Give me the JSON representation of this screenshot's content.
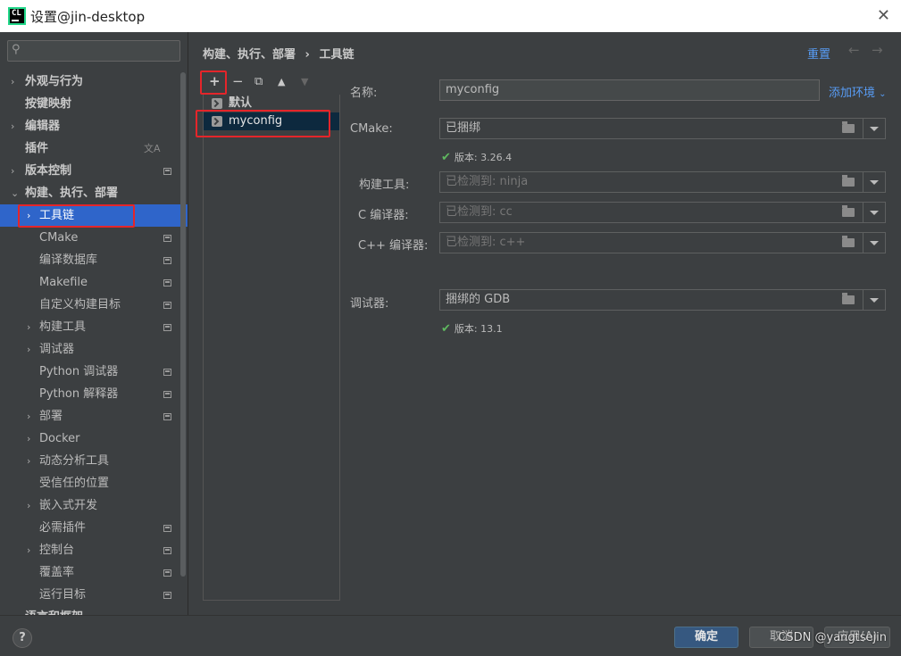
{
  "window": {
    "title": "设置@jin-desktop"
  },
  "search": {
    "placeholder": ""
  },
  "sidebar": {
    "items": [
      {
        "label": "外观与行为"
      },
      {
        "label": "按键映射"
      },
      {
        "label": "编辑器"
      },
      {
        "label": "插件"
      },
      {
        "label": "版本控制"
      },
      {
        "label": "构建、执行、部署"
      },
      {
        "label": "工具链"
      },
      {
        "label": "CMake"
      },
      {
        "label": "编译数据库"
      },
      {
        "label": "Makefile"
      },
      {
        "label": "自定义构建目标"
      },
      {
        "label": "构建工具"
      },
      {
        "label": "调试器"
      },
      {
        "label": "Python 调试器"
      },
      {
        "label": "Python 解释器"
      },
      {
        "label": "部署"
      },
      {
        "label": "Docker"
      },
      {
        "label": "动态分析工具"
      },
      {
        "label": "受信任的位置"
      },
      {
        "label": "嵌入式开发"
      },
      {
        "label": "必需插件"
      },
      {
        "label": "控制台"
      },
      {
        "label": "覆盖率"
      },
      {
        "label": "运行目标"
      },
      {
        "label": "语言和框架"
      }
    ]
  },
  "header": {
    "crumb_parent": "构建、执行、部署",
    "crumb_sep": "›",
    "crumb_current": "工具链",
    "reset": "重置"
  },
  "toolchains": {
    "items": [
      {
        "label": "默认"
      },
      {
        "label": "myconfig"
      }
    ]
  },
  "form": {
    "name_label": "名称:",
    "name_value": "myconfig",
    "add_env": "添加环境",
    "cmake_label": "CMake:",
    "cmake_value": "已捆绑",
    "cmake_version": "版本: 3.26.4",
    "build_tool_label": "构建工具:",
    "build_tool_value": "已检测到: ninja",
    "c_compiler_label": "C 编译器:",
    "c_compiler_value": "已检测到: cc",
    "cpp_compiler_label": "C++ 编译器:",
    "cpp_compiler_value": "已检测到: c++",
    "debugger_label": "调试器:",
    "debugger_value": "捆绑的 GDB",
    "debugger_version": "版本: 13.1"
  },
  "footer": {
    "help": "?",
    "ok": "确定",
    "cancel": "取消",
    "apply": "应用(A)",
    "watermark": "CSDN @yangtsejin"
  },
  "colors": {
    "accent": "#2f65ca",
    "link": "#589df6",
    "highlight_box": "#e5252a",
    "check": "#5fb85f"
  }
}
